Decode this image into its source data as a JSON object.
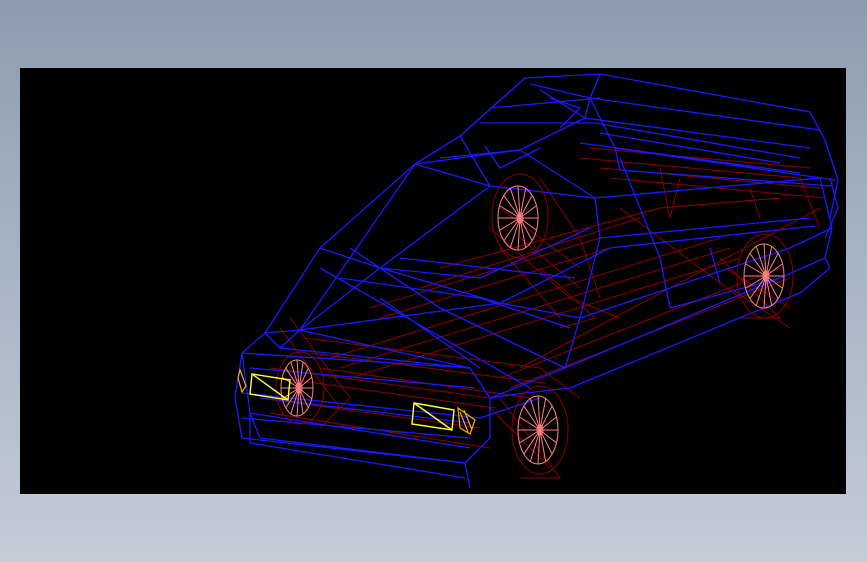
{
  "viewport": {
    "background": "#000000",
    "model": "car-wireframe"
  },
  "colors": {
    "page_gradient_top": "#8c9cae",
    "page_gradient_bottom": "#c3ccd7",
    "body_edges": "#1a1aff",
    "hidden_edges": "#8a0000",
    "wheel_spokes": "#ff8080",
    "headlights": "#ffff33",
    "indicators": "#ffaa00"
  },
  "wheels": [
    {
      "name": "front-left",
      "spokes": 16
    },
    {
      "name": "front-right",
      "spokes": 16
    },
    {
      "name": "rear-left",
      "spokes": 16
    },
    {
      "name": "rear-right",
      "spokes": 16
    }
  ]
}
